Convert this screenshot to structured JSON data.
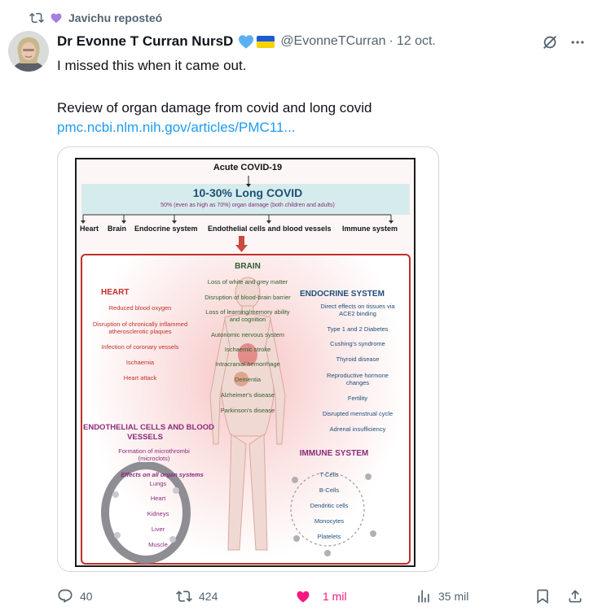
{
  "repost": {
    "label": "Javichu reposteó"
  },
  "author": {
    "name": "Dr Evonne T Curran NursD",
    "handle": "@EvonneTCurran",
    "date": "12 oct."
  },
  "tweet": {
    "line1": "I missed this when it came out.",
    "line2": "Review of organ damage from covid and long covid",
    "link": "pmc.ncbi.nlm.nih.gov/articles/PMC11..."
  },
  "figure": {
    "top_title": "Acute COVID-19",
    "banner_title": "10-30% Long COVID",
    "banner_sub": "50% (even as high as 70%) organ damage (both children and adults)",
    "branches": [
      "Heart",
      "Brain",
      "Endocrine system",
      "Endothelial cells and blood vessels",
      "Immune system"
    ],
    "brain": {
      "title": "BRAIN",
      "items": [
        "Loss of white and grey matter",
        "Disruption of blood-brain barrier",
        "Loss of learning/memory ability",
        "and cognition",
        "Autonomic nervous system",
        "Ischaemic stroke",
        "Intracranial hemorrhage",
        "Dementia",
        "Alzheimer's disease",
        "Parkinson's disease"
      ]
    },
    "heart": {
      "title": "HEART",
      "items": [
        "Reduced blood oxygen",
        "Disruption of chronically inflammed",
        "atherosclerotic plaques",
        "Infection of coronary vessels",
        "Ischaemia",
        "Heart attack"
      ]
    },
    "endocrine": {
      "title": "ENDOCRINE SYSTEM",
      "items": [
        "Direct effects on tissues via",
        "ACE2 binding",
        "Type 1 and 2 Diabetes",
        "Cushing's syndrome",
        "Thyroid disease",
        "Reproductive hormone",
        "changes",
        "Fertility",
        "Disrupted menstrual cycle",
        "Adrenal insufficiency"
      ]
    },
    "endothelial": {
      "title_line1": "ENDOTHELIAL CELLS AND BLOOD",
      "title_line2": "VESSELS",
      "items": [
        "Formation of microthrombi",
        "(microclots)"
      ],
      "subtitle": "Effects on all organ systems",
      "organs": [
        "Lungs",
        "Heart",
        "Kidneys",
        "Liver",
        "Muscle"
      ]
    },
    "immune": {
      "title": "IMMUNE SYSTEM",
      "items": [
        "T-Cells",
        "B-Cells",
        "Dendritic cells",
        "Monocytes",
        "Platelets"
      ]
    }
  },
  "actions": {
    "replies": "40",
    "reposts": "424",
    "likes": "1 mil",
    "views": "35 mil"
  },
  "colors": {
    "link": "#1d9bf0",
    "like": "#f91880",
    "repost_heart": "#a87ee0",
    "fig_red": "#c0302b",
    "fig_blue": "#1f4e79",
    "fig_purple": "#8b2a7a",
    "fig_green": "#2e5e2e"
  }
}
